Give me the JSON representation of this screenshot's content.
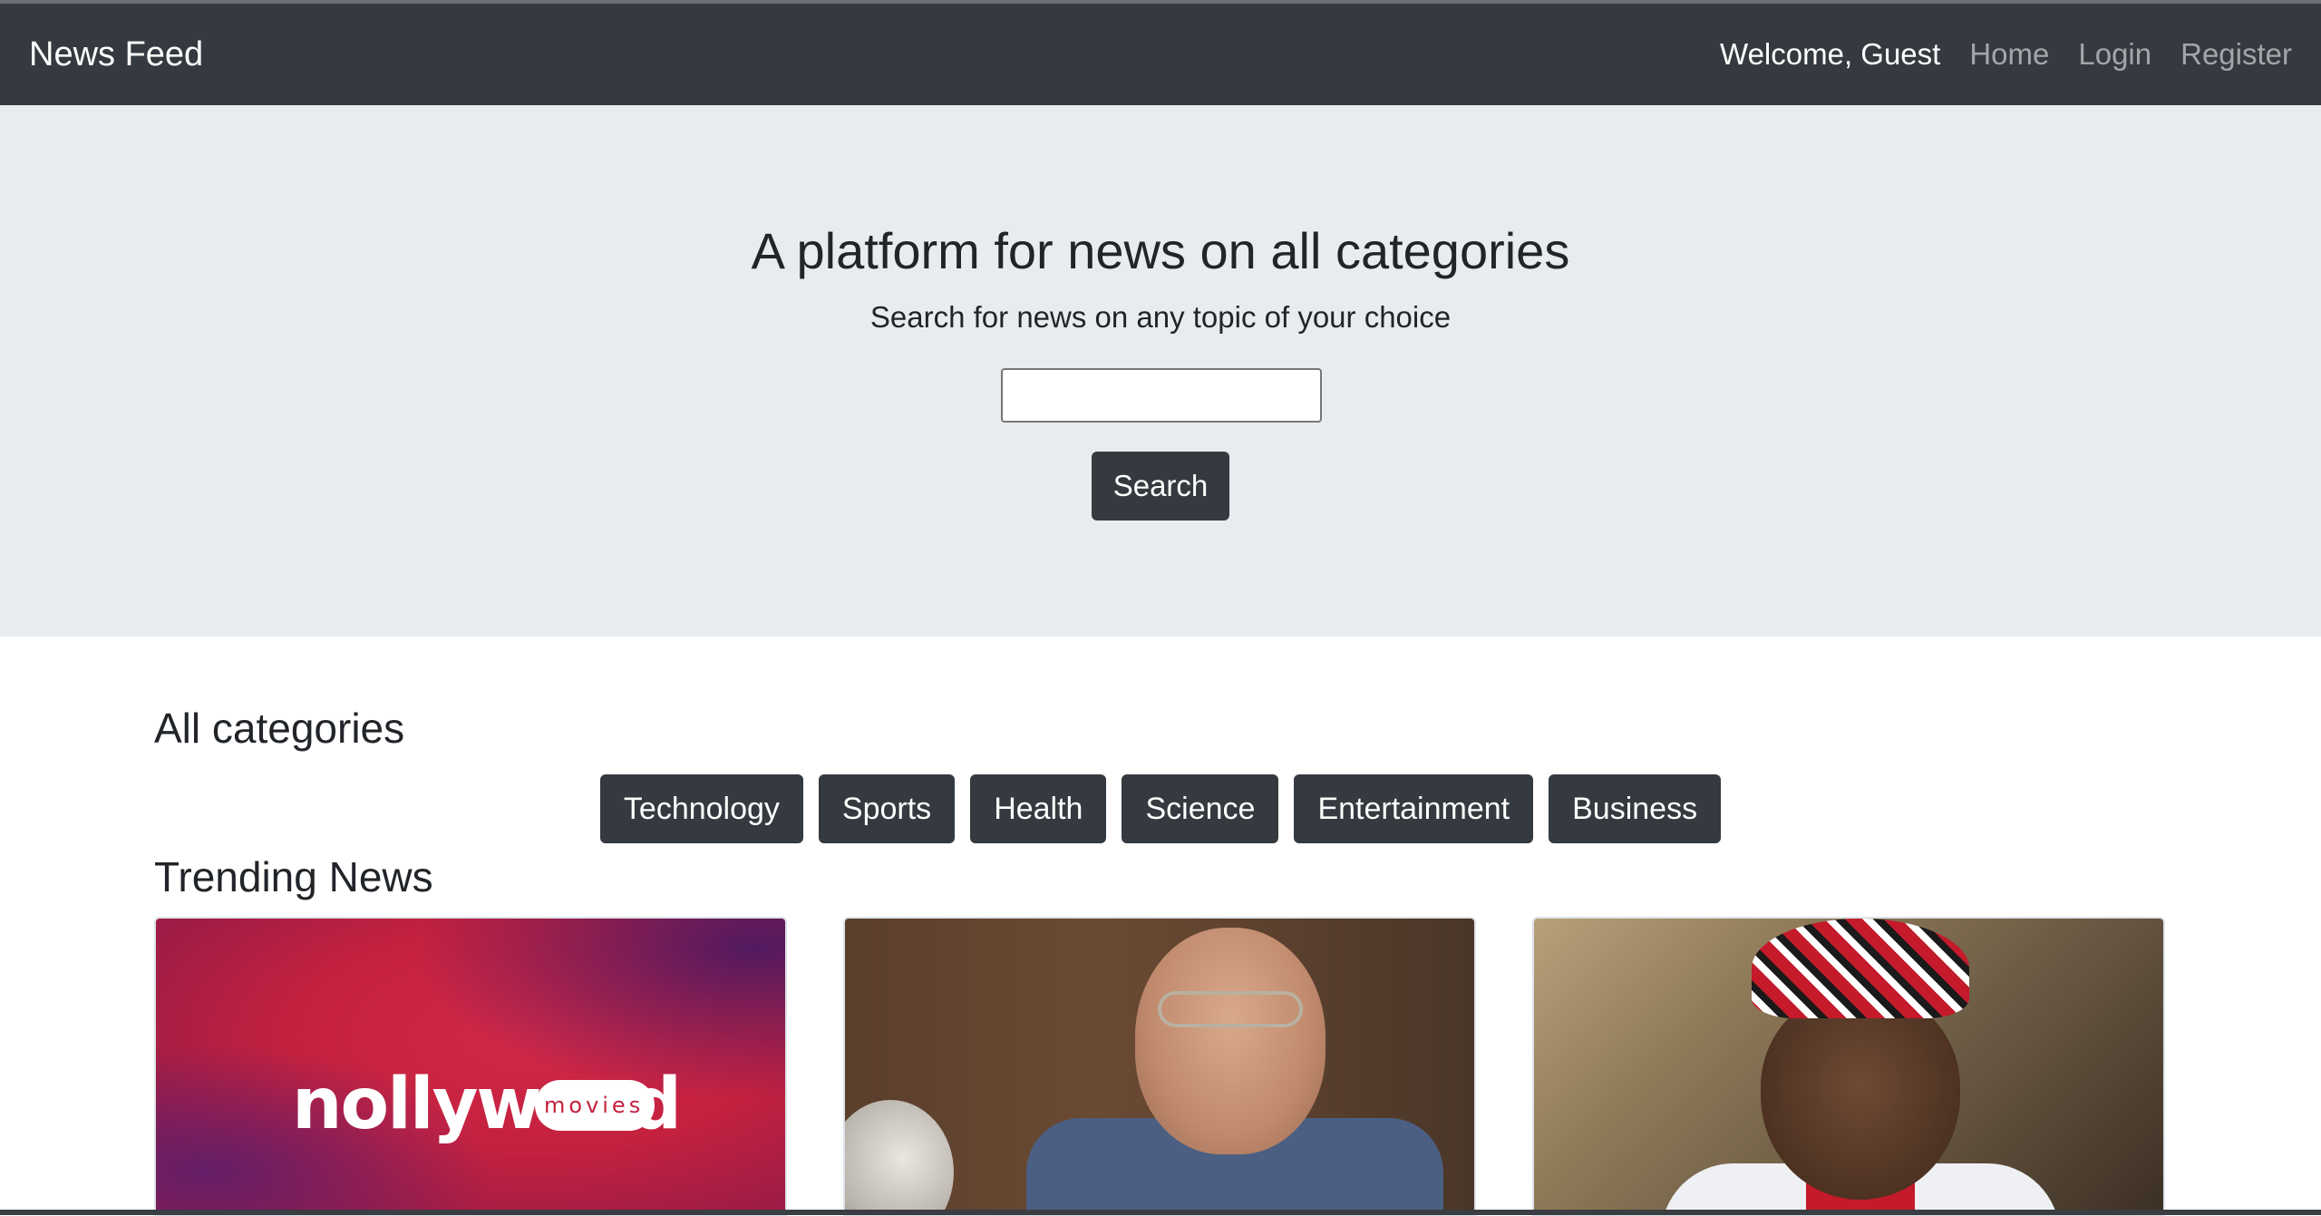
{
  "navbar": {
    "brand": "News Feed",
    "welcome": "Welcome, Guest",
    "links": [
      "Home",
      "Login",
      "Register"
    ]
  },
  "hero": {
    "title": "A platform for news on all categories",
    "subtitle": "Search for news on any topic of your choice",
    "search_value": "",
    "search_button": "Search"
  },
  "categories": {
    "title": "All categories",
    "items": [
      "Technology",
      "Sports",
      "Health",
      "Science",
      "Entertainment",
      "Business"
    ]
  },
  "trending": {
    "title": "Trending News",
    "cards": [
      {
        "image": "nollywood-movies-image",
        "logo_text": "nollyw",
        "logo_tail": "d",
        "logo_sub": "movies"
      },
      {
        "image": "man-with-glasses-image"
      },
      {
        "image": "man-in-red-hat-image"
      }
    ]
  },
  "colors": {
    "navbar_bg": "#343a40",
    "hero_bg": "#e9ecef",
    "button_bg": "#343a40"
  }
}
